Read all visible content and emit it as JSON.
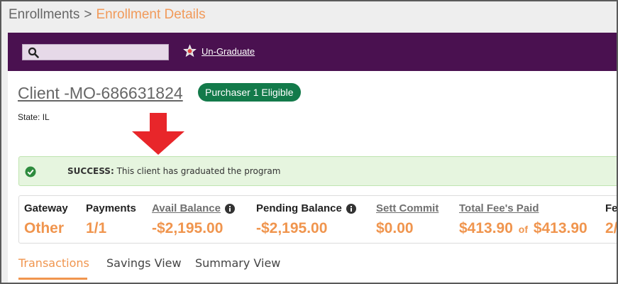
{
  "breadcrumb": {
    "parent": "Enrollments",
    "separator": ">",
    "current": "Enrollment Details"
  },
  "toolbar": {
    "search_placeholder": "",
    "search_icon": "search-icon",
    "ungraduate_icon": "star-icon",
    "ungraduate_label": "Un-Graduate"
  },
  "client": {
    "title": "Client -MO-686631824",
    "badge": "Purchaser 1 Eligible",
    "state_label": "State: IL"
  },
  "alert": {
    "icon": "check-circle-icon",
    "bold": "SUCCESS:",
    "message": " This client has graduated the program"
  },
  "stats": [
    {
      "label": "Gateway",
      "value": "Other",
      "link": false
    },
    {
      "label": "Payments",
      "value": "1/1",
      "link": false
    },
    {
      "label": "Avail Balance",
      "value": "-$2,195.00",
      "link": true,
      "info": true
    },
    {
      "label": "Pending Balance",
      "value": "-$2,195.00",
      "link": false,
      "info": true
    },
    {
      "label": "Sett Commit",
      "value": "$0.00",
      "link": true
    },
    {
      "label": "Total Fee's Paid",
      "value": "$413.90",
      "of": "of",
      "value2": "$413.90",
      "link": true
    },
    {
      "label": "Fe",
      "value": "2/",
      "link": false
    }
  ],
  "tabs": [
    {
      "label": "Transactions",
      "active": true
    },
    {
      "label": "Savings View",
      "active": false
    },
    {
      "label": "Summary View",
      "active": false
    }
  ],
  "colors": {
    "header_bg": "#4a1150",
    "accent": "#f0954e",
    "badge_bg": "#137a4a",
    "alert_bg": "#e6f5df",
    "arrow": "#e8262a"
  }
}
